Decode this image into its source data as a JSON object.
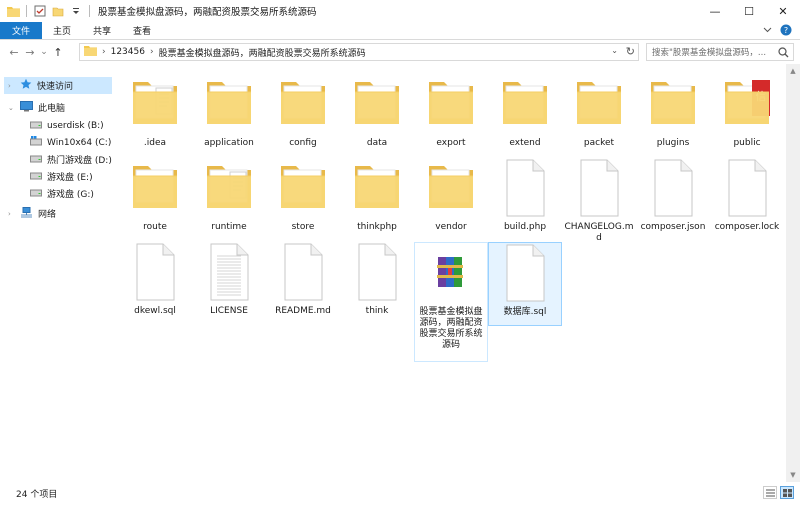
{
  "window": {
    "title": "股票基金模拟盘源码，两融配资股票交易所系统源码",
    "controls": {
      "minimize": "—",
      "maximize": "☐",
      "close": "✕"
    }
  },
  "ribbon": {
    "tabs": [
      "文件",
      "主页",
      "共享",
      "查看"
    ],
    "accent": "#1979ca"
  },
  "address": {
    "back": "←",
    "forward": "→",
    "recent": "⌄",
    "up": "↑",
    "crumbs": [
      "123456",
      "股票基金模拟盘源码，两融配资股票交易所系统源码"
    ],
    "search_placeholder": "搜索\"股票基金模拟盘源码，...",
    "refresh": "↻"
  },
  "sidebar": {
    "items": [
      {
        "label": "快速访问",
        "icon": "star-icon",
        "selected": true
      },
      {
        "label": "此电脑",
        "icon": "computer-icon",
        "selected": false
      },
      {
        "label": "userdisk (B:)",
        "icon": "drive-icon",
        "selected": false
      },
      {
        "label": "Win10x64 (C:)",
        "icon": "windows-drive-icon",
        "selected": false
      },
      {
        "label": "热门游戏盘 (D:)",
        "icon": "drive-icon",
        "selected": false
      },
      {
        "label": "游戏盘 (E:)",
        "icon": "drive-icon",
        "selected": false
      },
      {
        "label": "游戏盘 (G:)",
        "icon": "drive-icon",
        "selected": false
      },
      {
        "label": "网络",
        "icon": "network-icon",
        "selected": false
      }
    ]
  },
  "files": [
    {
      "name": ".idea",
      "kind": "folder-doc"
    },
    {
      "name": "application",
      "kind": "folder"
    },
    {
      "name": "config",
      "kind": "folder"
    },
    {
      "name": "data",
      "kind": "folder"
    },
    {
      "name": "export",
      "kind": "folder"
    },
    {
      "name": "extend",
      "kind": "folder"
    },
    {
      "name": "packet",
      "kind": "folder"
    },
    {
      "name": "plugins",
      "kind": "folder"
    },
    {
      "name": "public",
      "kind": "folder-red"
    },
    {
      "name": "route",
      "kind": "folder"
    },
    {
      "name": "runtime",
      "kind": "folder-doc"
    },
    {
      "name": "store",
      "kind": "folder"
    },
    {
      "name": "thinkphp",
      "kind": "folder"
    },
    {
      "name": "vendor",
      "kind": "folder"
    },
    {
      "name": "build.php",
      "kind": "file"
    },
    {
      "name": "CHANGELOG.md",
      "kind": "file"
    },
    {
      "name": "composer.json",
      "kind": "file"
    },
    {
      "name": "composer.lock",
      "kind": "file"
    },
    {
      "name": "dkewl.sql",
      "kind": "file"
    },
    {
      "name": "LICENSE",
      "kind": "file-lines"
    },
    {
      "name": "README.md",
      "kind": "file"
    },
    {
      "name": "think",
      "kind": "file"
    },
    {
      "name": "股票基金模拟盘源码，两融配资股票交易所系统源码",
      "kind": "rar"
    },
    {
      "name": "数据库.sql",
      "kind": "file",
      "selected": true
    }
  ],
  "status": {
    "count_text": "24 个项目"
  },
  "colors": {
    "folder": "#f8d775",
    "folder_dark": "#e8b94a",
    "selection": "#cce8ff"
  }
}
